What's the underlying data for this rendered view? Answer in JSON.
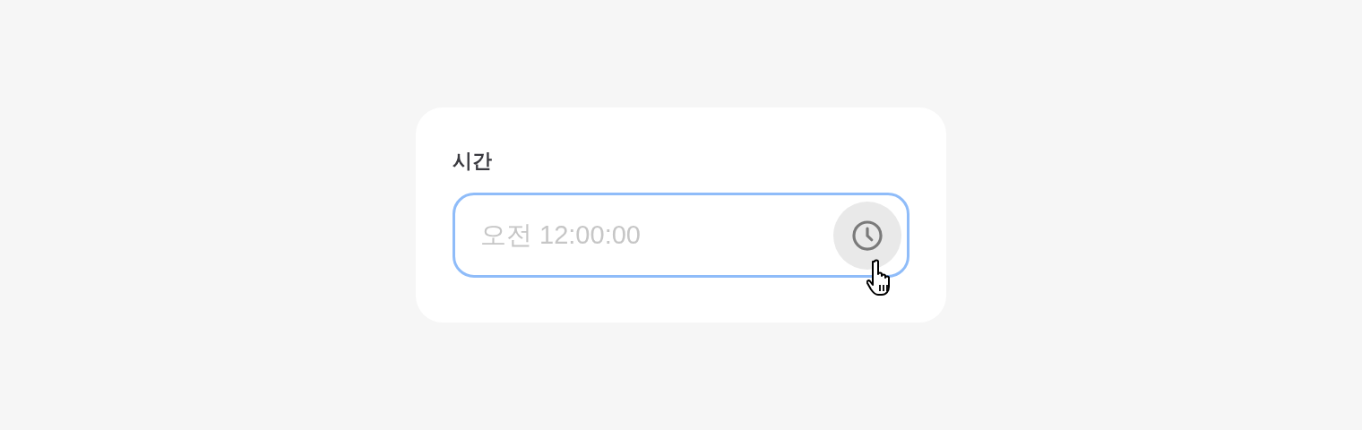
{
  "field": {
    "label": "시간",
    "placeholder": "오전 12:00:00",
    "focused": true
  },
  "clock_button": {
    "hovered": true
  }
}
